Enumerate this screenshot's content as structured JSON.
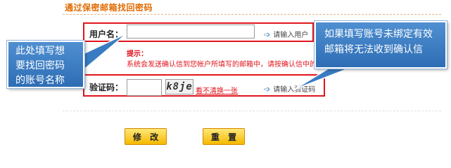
{
  "section": {
    "title": "通过保密邮箱找回密码"
  },
  "form": {
    "username_label": "用户名：",
    "username_value": "",
    "username_hint": "请输入用户",
    "notice_label": "提示：",
    "notice_text": "系统会发送确认信到您帐户所填写的邮箱中，请按确认信中的提示",
    "captcha_label": "验证码：",
    "captcha_value": "",
    "captcha_image_text": "k8je",
    "captcha_refresh": "看不清换一张",
    "captcha_hint": "请输入验证码"
  },
  "buttons": {
    "submit": "修 改",
    "reset": "重 置"
  },
  "callouts": {
    "left_lines": [
      "此处填写想",
      "要找回密码",
      "的账号名称"
    ],
    "right_lines": [
      "如果填写账号未绑定有效",
      "邮箱将无法收到确认信"
    ]
  },
  "colors": {
    "accent_orange": "#e06a00",
    "highlight_red": "#e0141c",
    "callout_blue": "#3a7cc2",
    "button_yellow": "#f5b800"
  }
}
